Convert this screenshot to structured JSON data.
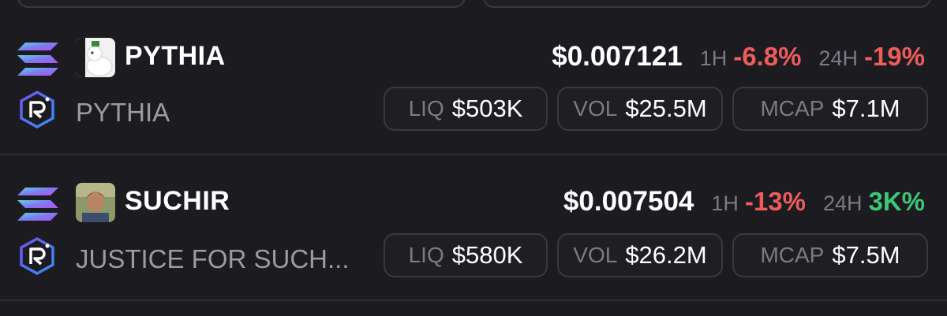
{
  "tokens": [
    {
      "symbol": "PYTHIA",
      "name": "PYTHIA",
      "price": "$0.007121",
      "change_1h_label": "1H",
      "change_1h": "-6.8%",
      "change_24h_label": "24H",
      "change_24h": "-19%",
      "liq_label": "LIQ",
      "liq": "$503K",
      "vol_label": "VOL",
      "vol": "$25.5M",
      "mcap_label": "MCAP",
      "mcap": "$7.1M"
    },
    {
      "symbol": "SUCHIR",
      "name": "JUSTICE FOR SUCH...",
      "price": "$0.007504",
      "change_1h_label": "1H",
      "change_1h": "-13%",
      "change_24h_label": "24H",
      "change_24h": "3K%",
      "liq_label": "LIQ",
      "liq": "$580K",
      "vol_label": "VOL",
      "vol": "$26.2M",
      "mcap_label": "MCAP",
      "mcap": "$7.5M"
    }
  ],
  "colors": {
    "negative": "#ee5c5c",
    "positive": "#3ec677",
    "background": "#1c1b20"
  },
  "icons": {
    "chain": "solana-icon",
    "dex": "raydium-icon"
  }
}
